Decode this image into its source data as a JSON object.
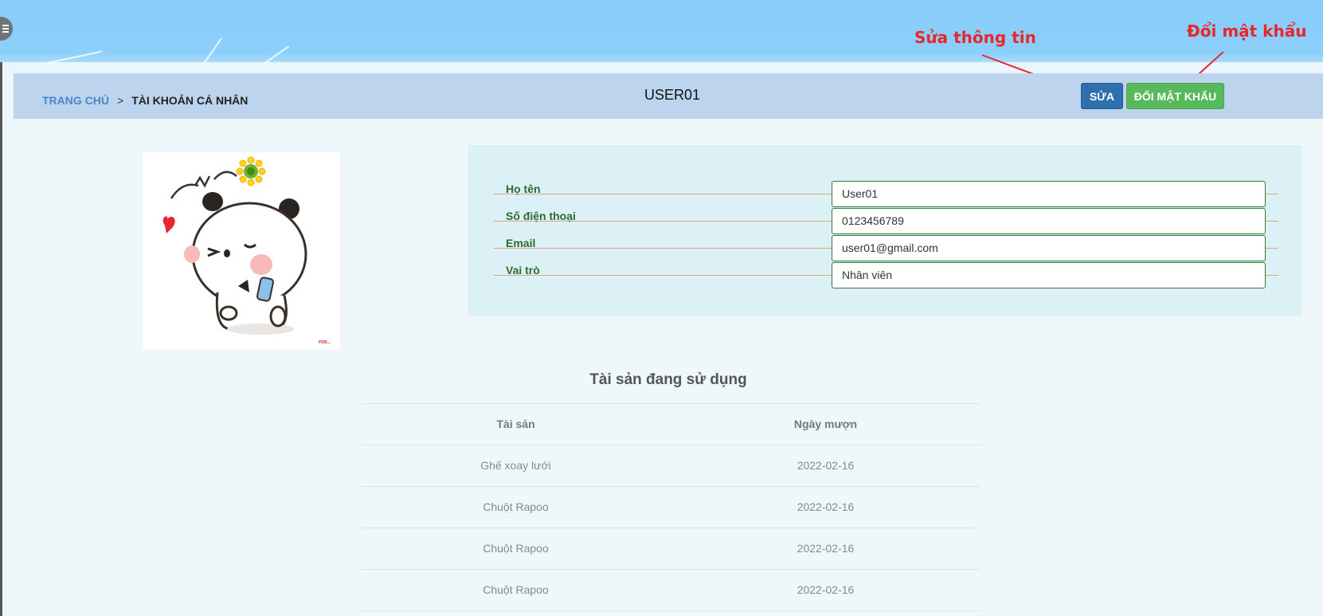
{
  "annotations": {
    "edit_info": "Sửa thông tin",
    "change_password": "Đổi mật khẩu"
  },
  "breadcrumb": {
    "home": "TRANG CHỦ",
    "separator": ">",
    "current": "TÀI KHOẢN CÁ NHÂN"
  },
  "header": {
    "username": "USER01",
    "edit_button": "SỬA",
    "change_password_button": "ĐỔI MẬT KHẨU"
  },
  "profile": {
    "avatar_watermark": "PDR...",
    "fields": [
      {
        "label": "Họ tên",
        "value": "User01"
      },
      {
        "label": "Số điện thoại",
        "value": "0123456789"
      },
      {
        "label": "Email",
        "value": "user01@gmail.com"
      },
      {
        "label": "Vai trò",
        "value": "Nhân viên"
      }
    ]
  },
  "assets": {
    "title": "Tài sản đang sử dụng",
    "columns": [
      "Tài sản",
      "Ngày mượn"
    ],
    "rows": [
      [
        "Ghế xoay lưới",
        "2022-02-16"
      ],
      [
        "Chuột Rapoo",
        "2022-02-16"
      ],
      [
        "Chuột Rapoo",
        "2022-02-16"
      ],
      [
        "Chuột Rapoo",
        "2022-02-16"
      ]
    ]
  },
  "colors": {
    "top_bar": "#87ccfb",
    "header_strip": "#bcd4ee",
    "edit_button": "#2f6fad",
    "change_password_button": "#58b95b",
    "annotation": "#e8262b",
    "label_green": "#2e6b34"
  },
  "icons": {
    "menu": "hamburger-menu-icon"
  }
}
